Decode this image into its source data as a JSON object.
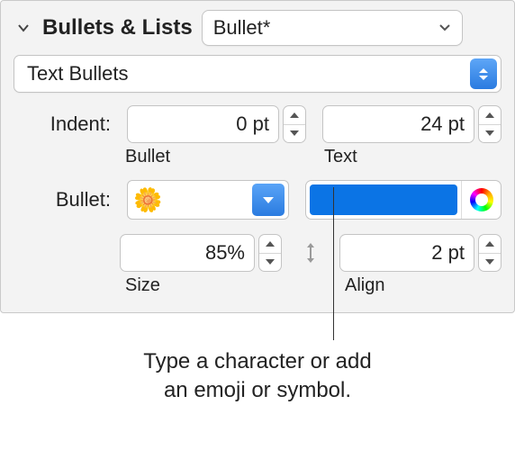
{
  "section": {
    "title": "Bullets & Lists"
  },
  "style_picker": {
    "value": "Bullet*"
  },
  "bullet_type": {
    "value": "Text Bullets"
  },
  "indent": {
    "label": "Indent:",
    "bullet": {
      "value": "0 pt",
      "caption": "Bullet"
    },
    "text": {
      "value": "24 pt",
      "caption": "Text"
    }
  },
  "bullet": {
    "label": "Bullet:",
    "glyph": "🌼",
    "color": "#0b74e5"
  },
  "size": {
    "value": "85%",
    "caption": "Size"
  },
  "align": {
    "value": "2 pt",
    "caption": "Align"
  },
  "callout": {
    "line1": "Type a character or add",
    "line2": "an emoji or symbol."
  }
}
